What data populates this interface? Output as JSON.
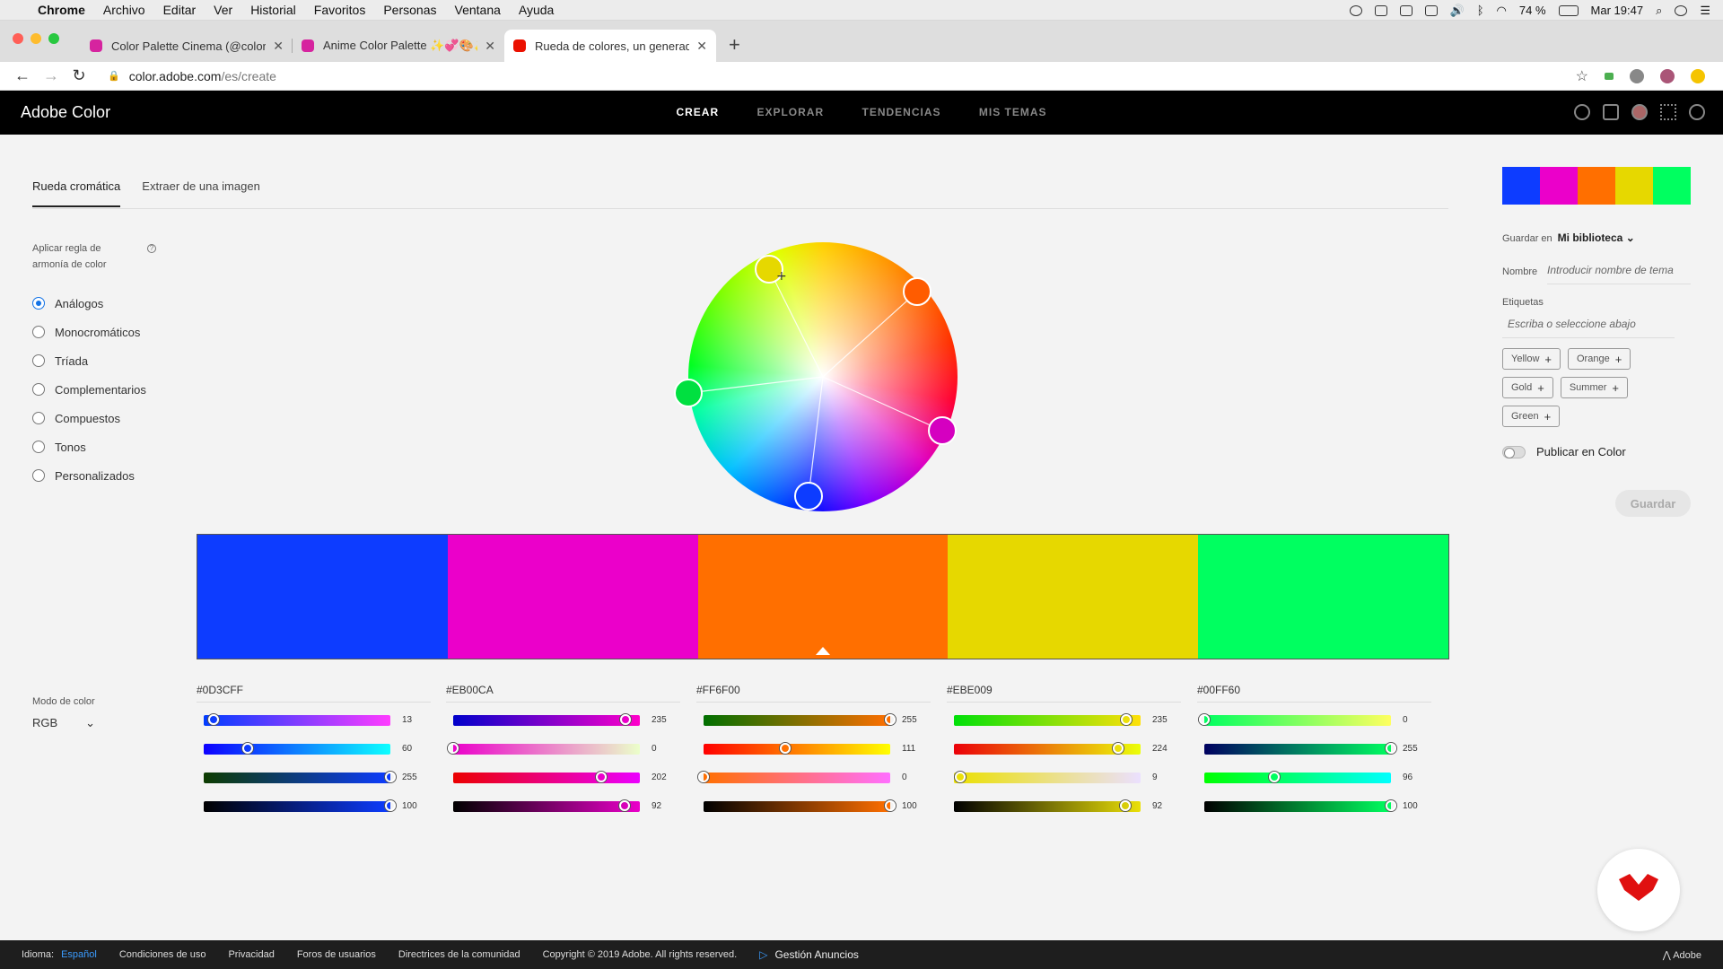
{
  "menubar": {
    "app": "Chrome",
    "items": [
      "Archivo",
      "Editar",
      "Ver",
      "Historial",
      "Favoritos",
      "Personas",
      "Ventana",
      "Ayuda"
    ],
    "battery": "74 %",
    "clock": "Mar 19:47"
  },
  "tabs": [
    {
      "title": "Color Palette Cinema (@colorp",
      "active": false,
      "favicon_color": "#d6249f"
    },
    {
      "title": "Anime Color Palette ✨💞🎨✨",
      "active": false,
      "favicon_color": "#d6249f"
    },
    {
      "title": "Rueda de colores, un generado",
      "active": true,
      "favicon_color": "#eb1000"
    }
  ],
  "address": {
    "host": "color.adobe.com",
    "path": "/es/create"
  },
  "header": {
    "logo": "Adobe Color",
    "nav": [
      {
        "label": "CREAR",
        "active": true
      },
      {
        "label": "EXPLORAR",
        "active": false
      },
      {
        "label": "TENDENCIAS",
        "active": false
      },
      {
        "label": "MIS TEMAS",
        "active": false
      }
    ]
  },
  "subtabs": [
    {
      "label": "Rueda cromática",
      "active": true
    },
    {
      "label": "Extraer de una imagen",
      "active": false
    }
  ],
  "harmony": {
    "title": "Aplicar regla de armonía de color",
    "options": [
      {
        "label": "Análogos",
        "selected": true
      },
      {
        "label": "Monocromáticos",
        "selected": false
      },
      {
        "label": "Tríada",
        "selected": false
      },
      {
        "label": "Complementarios",
        "selected": false
      },
      {
        "label": "Compuestos",
        "selected": false
      },
      {
        "label": "Tonos",
        "selected": false
      },
      {
        "label": "Personalizados",
        "selected": false
      }
    ]
  },
  "wheel_handles_colors": [
    "#E6D800",
    "#FF5C00",
    "#00E040",
    "#D500C0",
    "#0D3CFF"
  ],
  "palette": [
    {
      "hex": "#0D3CFF",
      "color": "#0D3CFF",
      "base": false,
      "values": [
        13,
        60,
        255,
        100
      ],
      "channel_max": [
        255,
        255,
        255,
        100
      ],
      "gradients": [
        "linear-gradient(90deg,#003cff,#ff3cff)",
        "linear-gradient(90deg,#0d00ff,#0dffff)",
        "linear-gradient(90deg,#0d3c00,#0d3cff)",
        "linear-gradient(90deg,#000,#0d3cff)"
      ]
    },
    {
      "hex": "#EB00CA",
      "color": "#EB00CA",
      "base": false,
      "values": [
        235,
        0,
        202,
        92
      ],
      "channel_max": [
        255,
        255,
        255,
        100
      ],
      "gradients": [
        "linear-gradient(90deg,#0000ca,#ff00ca)",
        "linear-gradient(90deg,#eb00ca,#ebffca)",
        "linear-gradient(90deg,#eb0000,#eb00ff)",
        "linear-gradient(90deg,#000,#eb00ca)"
      ]
    },
    {
      "hex": "#FF6F00",
      "color": "#FF6F00",
      "base": true,
      "values": [
        255,
        111,
        0,
        100
      ],
      "channel_max": [
        255,
        255,
        255,
        100
      ],
      "gradients": [
        "linear-gradient(90deg,#006f00,#ff6f00)",
        "linear-gradient(90deg,#ff0000,#ffff00)",
        "linear-gradient(90deg,#ff6f00,#ff6fff)",
        "linear-gradient(90deg,#000,#ff6f00)"
      ]
    },
    {
      "hex": "#EBE009",
      "color": "#E6D800",
      "base": false,
      "values": [
        235,
        224,
        9,
        92
      ],
      "channel_max": [
        255,
        255,
        255,
        100
      ],
      "gradients": [
        "linear-gradient(90deg,#00e009,#ffe009)",
        "linear-gradient(90deg,#eb0009,#ebff09)",
        "linear-gradient(90deg,#ebe000,#ebe0ff)",
        "linear-gradient(90deg,#000,#ebe009)"
      ]
    },
    {
      "hex": "#00FF60",
      "color": "#00FF60",
      "base": false,
      "values": [
        0,
        255,
        96,
        100
      ],
      "channel_max": [
        255,
        255,
        255,
        100
      ],
      "gradients": [
        "linear-gradient(90deg,#00ff60,#ffff60)",
        "linear-gradient(90deg,#000060,#00ff60)",
        "linear-gradient(90deg,#00ff00,#00ffff)",
        "linear-gradient(90deg,#000,#00ff60)"
      ]
    }
  ],
  "mode": {
    "label": "Modo de color",
    "value": "RGB"
  },
  "sidebar": {
    "save_to_label": "Guardar en",
    "library": "Mi biblioteca",
    "name_label": "Nombre",
    "name_placeholder": "Introducir nombre de tema",
    "tags_label": "Etiquetas",
    "tags_placeholder": "Escriba o seleccione abajo",
    "tags": [
      "Yellow",
      "Orange",
      "Gold",
      "Summer",
      "Green"
    ],
    "publish_label": "Publicar en Color",
    "save_label": "Guardar"
  },
  "footer": {
    "lang_label": "Idioma:",
    "lang": "Español",
    "links": [
      "Condiciones de uso",
      "Privacidad",
      "Foros de usuarios",
      "Directrices de la comunidad"
    ],
    "copyright": "Copyright © 2019 Adobe. All rights reserved.",
    "ads": "Gestión Anuncios",
    "brand": "Adobe"
  }
}
